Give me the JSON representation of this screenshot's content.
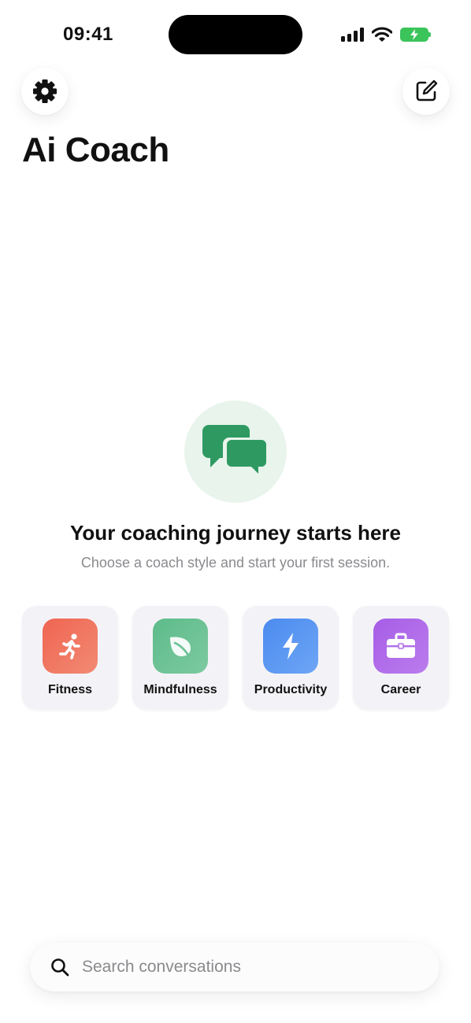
{
  "status_bar": {
    "time": "09:41",
    "icons": [
      "cellular-signal-icon",
      "wifi-icon",
      "battery-charging-icon"
    ],
    "battery_color": "#3bc45a"
  },
  "header": {
    "settings_icon": "gear-icon",
    "compose_icon": "compose-icon",
    "title": "Ai Coach"
  },
  "empty_state": {
    "icon": "chat-bubbles-icon",
    "icon_color": "#2e9a62",
    "icon_bg": "#e8f4ec",
    "heading": "Your coaching journey starts here",
    "subtitle": "Choose a coach style and start your first session."
  },
  "coach_styles": [
    {
      "label": "Fitness",
      "icon": "running-icon",
      "color": "#f06552"
    },
    {
      "label": "Mindfulness",
      "icon": "leaf-icon",
      "color": "#5dbb8a"
    },
    {
      "label": "Productivity",
      "icon": "lightning-icon",
      "color": "#4b8bef"
    },
    {
      "label": "Career",
      "icon": "briefcase-icon",
      "color": "#a65de6"
    }
  ],
  "search": {
    "icon": "search-icon",
    "placeholder": "Search conversations",
    "value": ""
  }
}
